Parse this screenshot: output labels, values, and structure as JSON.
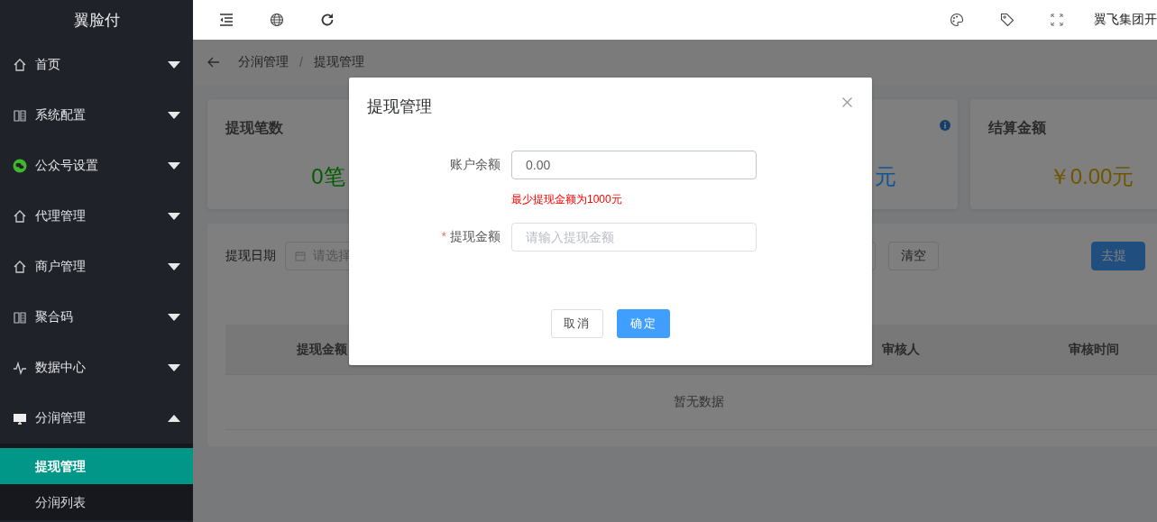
{
  "app": {
    "logo": "翼脸付"
  },
  "sidebar": {
    "items": [
      {
        "label": "首页",
        "kind": "house",
        "expanded": false
      },
      {
        "label": "系统配置",
        "kind": "book",
        "expanded": false
      },
      {
        "label": "公众号设置",
        "kind": "chat",
        "expanded": false
      },
      {
        "label": "代理管理",
        "kind": "house",
        "expanded": false
      },
      {
        "label": "商户管理",
        "kind": "house",
        "expanded": false
      },
      {
        "label": "聚合码",
        "kind": "book",
        "expanded": false
      },
      {
        "label": "数据中心",
        "kind": "pulse",
        "expanded": false
      },
      {
        "label": "分润管理",
        "kind": "monitor",
        "expanded": true,
        "children": [
          {
            "label": "提现管理",
            "selected": true
          },
          {
            "label": "分润列表",
            "selected": false
          }
        ]
      }
    ]
  },
  "header": {
    "user": "翼飞集团开"
  },
  "breadcrumb": {
    "items": [
      "分润管理",
      "提现管理"
    ],
    "separator": "/"
  },
  "cards": [
    {
      "title": "提现笔数",
      "value": "0笔",
      "color": "#005c00",
      "kind": "full"
    },
    {
      "value": "元",
      "color": "#0e5596",
      "info": true,
      "kind": "cut"
    },
    {
      "title": "结算金额",
      "value": "￥0.00元",
      "color": "#6e5600",
      "kind": "full"
    }
  ],
  "filter": {
    "label": "提现日期",
    "placeholder": "请选择",
    "buttons": [
      {
        "kind": "plain"
      },
      {
        "label": "清空",
        "kind": "plain"
      },
      {
        "label": "去提",
        "kind": "primary"
      }
    ]
  },
  "table": {
    "columns": [
      "提现金额",
      "审核人",
      "审核时间"
    ],
    "empty": "暂无数据"
  },
  "dialog": {
    "title": "提现管理",
    "required_mark": "*",
    "fields": [
      {
        "label": "账户余额",
        "value": "0.00",
        "required": false,
        "hint": "最少提现金额为1000元"
      },
      {
        "label": "提现金额",
        "placeholder": "请输入提现金额",
        "required": true
      }
    ],
    "buttons": [
      {
        "label": "取消",
        "kind": "plain"
      },
      {
        "label": "确定",
        "kind": "primary"
      }
    ]
  }
}
